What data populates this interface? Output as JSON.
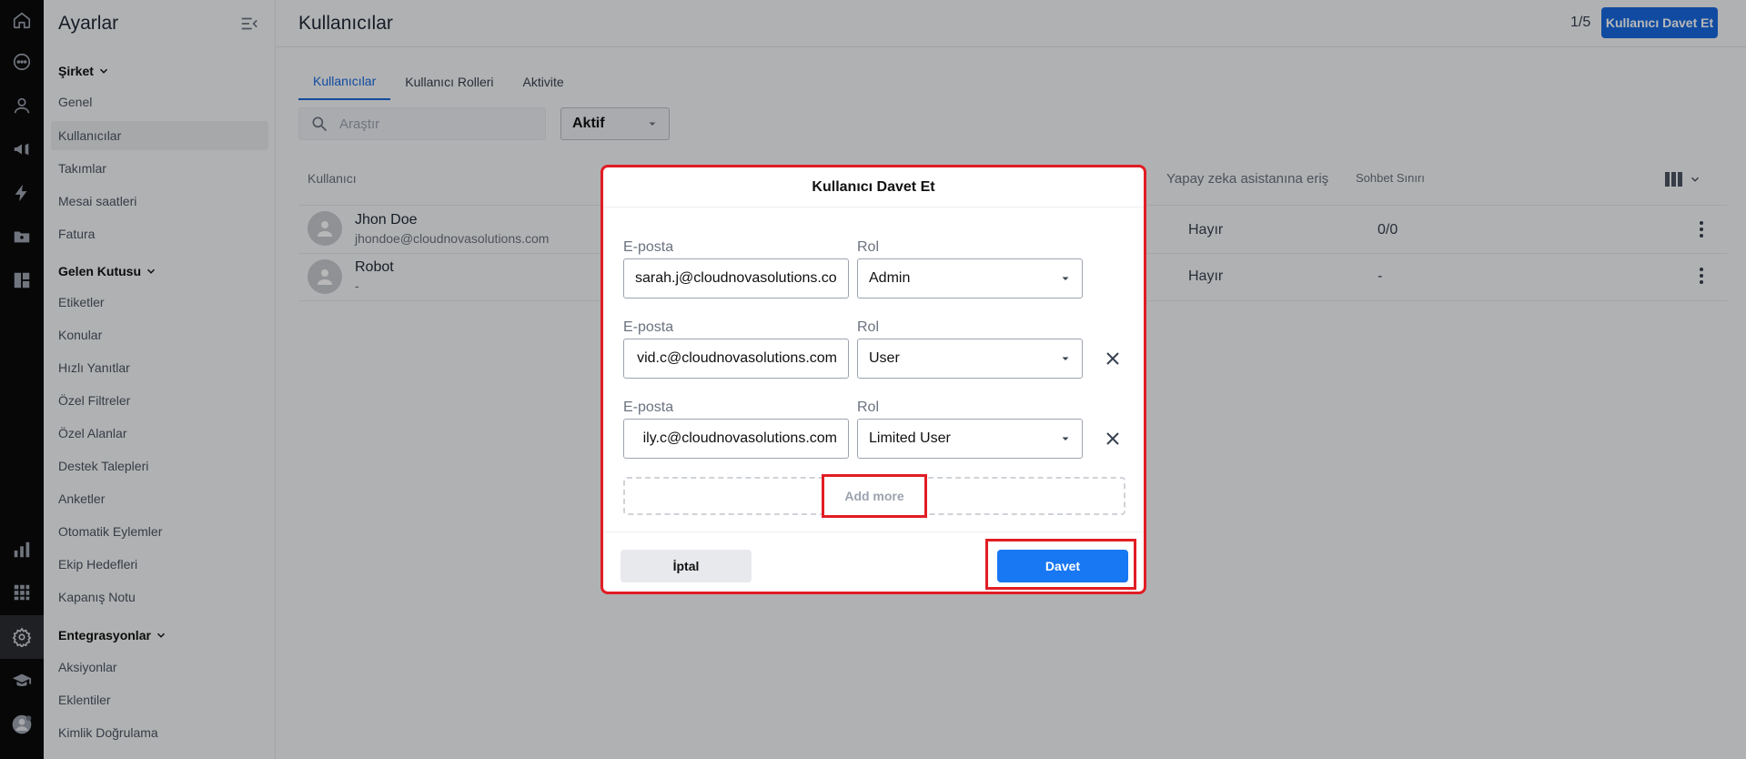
{
  "colors": {
    "accent": "#1769e0",
    "primary_button": "#1877f2",
    "highlight_red": "#e11d24",
    "rail_bg": "#0b0b0c"
  },
  "rail": {
    "icons": [
      "home-icon",
      "chat-icon",
      "person-icon",
      "megaphone-icon",
      "bolt-icon",
      "folder-user-icon",
      "dashboard-icon",
      "bar-chart-icon",
      "apps-grid-icon",
      "gear-icon",
      "graduation-cap-icon",
      "profile-avatar-icon"
    ]
  },
  "sidebar": {
    "title": "Ayarlar",
    "sections": [
      {
        "label": "Şirket",
        "items": [
          "Genel",
          "Kullanıcılar",
          "Takımlar",
          "Mesai saatleri",
          "Fatura"
        ]
      },
      {
        "label": "Gelen Kutusu",
        "items": [
          "Etiketler",
          "Konular",
          "Hızlı Yanıtlar",
          "Özel Filtreler",
          "Özel Alanlar",
          "Destek Talepleri",
          "Anketler",
          "Otomatik Eylemler",
          "Ekip Hedefleri",
          "Kapanış Notu"
        ]
      },
      {
        "label": "Entegrasyonlar",
        "items": [
          "Aksiyonlar",
          "Eklentiler",
          "Kimlik Doğrulama"
        ]
      }
    ],
    "active_item": "Kullanıcılar"
  },
  "header": {
    "title": "Kullanıcılar",
    "count": "1/5",
    "invite_button": "Kullanıcı Davet Et"
  },
  "tabs": [
    "Kullanıcılar",
    "Kullanıcı Rolleri",
    "Aktivite"
  ],
  "filters": {
    "search_placeholder": "Araştır",
    "status_value": "Aktif"
  },
  "table": {
    "columns": {
      "user": "Kullanıcı",
      "ai": "Yapay zeka asistanına eriş",
      "chat_limit": "Sohbet Sınırı"
    },
    "rows": [
      {
        "name": "Jhon Doe",
        "email": "jhondoe@cloudnovasolutions.com",
        "ai": "Hayır",
        "limit": "0/0"
      },
      {
        "name": "Robot",
        "email": "-",
        "ai": "Hayır",
        "limit": "-"
      }
    ]
  },
  "modal": {
    "title": "Kullanıcı Davet Et",
    "email_label": "E-posta",
    "role_label": "Rol",
    "invites": [
      {
        "email": "sarah.j@cloudnovasolutions.co",
        "role": "Admin"
      },
      {
        "email": "vid.c@cloudnovasolutions.com",
        "role": "User"
      },
      {
        "email": "ily.c@cloudnovasolutions.com",
        "role": "Limited User"
      }
    ],
    "add_more": "Add more",
    "cancel": "İptal",
    "submit": "Davet"
  }
}
